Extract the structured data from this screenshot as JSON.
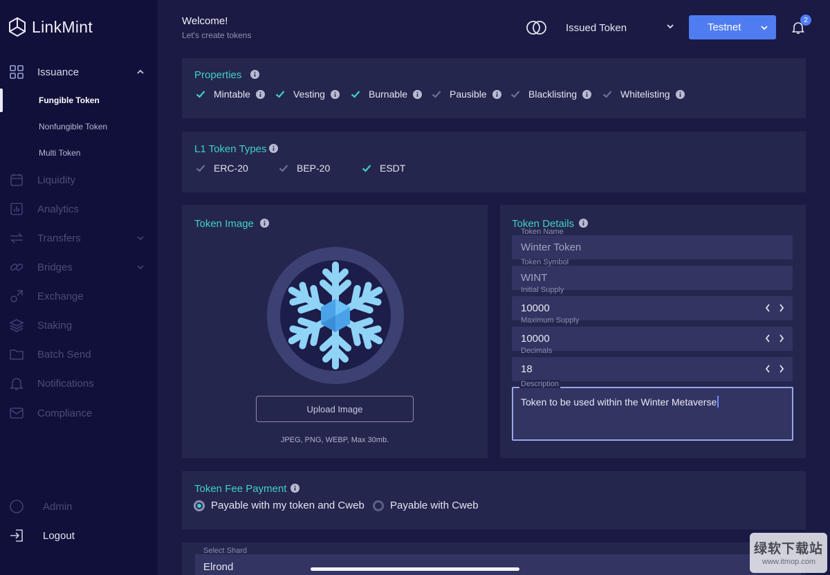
{
  "app": {
    "name": "LinkMint"
  },
  "sidebar": {
    "items": [
      {
        "label": "Issuance",
        "icon": "grid-icon"
      },
      {
        "label": "Liquidity",
        "icon": "calendar-icon"
      },
      {
        "label": "Analytics",
        "icon": "chart-icon"
      },
      {
        "label": "Transfers",
        "icon": "transfer-icon"
      },
      {
        "label": "Bridges",
        "icon": "link-icon"
      },
      {
        "label": "Exchange",
        "icon": "exchange-icon"
      },
      {
        "label": "Staking",
        "icon": "layers-icon"
      },
      {
        "label": "Batch Send",
        "icon": "folder-icon"
      },
      {
        "label": "Notifications",
        "icon": "bell-icon"
      },
      {
        "label": "Compliance",
        "icon": "mail-icon"
      }
    ],
    "sub_items": [
      {
        "label": "Fungible Token"
      },
      {
        "label": "Nonfungible Token"
      },
      {
        "label": "Multi Token"
      }
    ],
    "bottom": [
      {
        "label": "Admin",
        "icon": "circle-icon"
      },
      {
        "label": "Logout",
        "icon": "logout-icon"
      }
    ]
  },
  "header": {
    "welcome": "Welcome!",
    "subtitle": "Let's create tokens",
    "token_select": "Issued Token",
    "network": "Testnet",
    "notification_count": "2"
  },
  "properties": {
    "title": "Properties",
    "items": [
      {
        "label": "Mintable",
        "checked": true
      },
      {
        "label": "Vesting",
        "checked": true
      },
      {
        "label": "Burnable",
        "checked": true
      },
      {
        "label": "Pausible",
        "checked": false
      },
      {
        "label": "Blacklisting",
        "checked": false
      },
      {
        "label": "Whitelisting",
        "checked": false
      }
    ]
  },
  "l1_types": {
    "title": "L1 Token Types",
    "items": [
      {
        "label": "ERC-20",
        "checked": false
      },
      {
        "label": "BEP-20",
        "checked": false
      },
      {
        "label": "ESDT",
        "checked": true
      }
    ]
  },
  "token_image": {
    "title": "Token Image",
    "upload_label": "Upload Image",
    "hint": "JPEG, PNG, WEBP, Max 30mb."
  },
  "token_details": {
    "title": "Token Details",
    "name": {
      "label": "Token Name",
      "value": "Winter Token"
    },
    "symbol": {
      "label": "Token Symbol",
      "value": "WINT"
    },
    "initial_supply": {
      "label": "Initial Supply",
      "value": "10000"
    },
    "max_supply": {
      "label": "Maximum Supply",
      "value": "10000"
    },
    "decimals": {
      "label": "Decimals",
      "value": "18"
    },
    "description": {
      "label": "Description",
      "value": "Token to be used within the Winter Metaverse"
    }
  },
  "fee_payment": {
    "title": "Token Fee Payment",
    "options": [
      {
        "label": "Payable with my token and Cweb",
        "selected": true
      },
      {
        "label": "Payable with Cweb",
        "selected": false
      }
    ]
  },
  "shard": {
    "label": "Select Shard",
    "value": "Elrond"
  },
  "watermark": {
    "main": "绿软下载站",
    "sub": "www.itmop.com"
  },
  "colors": {
    "accent": "#3fd1c6",
    "primary": "#4f7cf0",
    "background": "#1a1a45",
    "sidebar": "#10103a",
    "panel": "#25264e"
  }
}
